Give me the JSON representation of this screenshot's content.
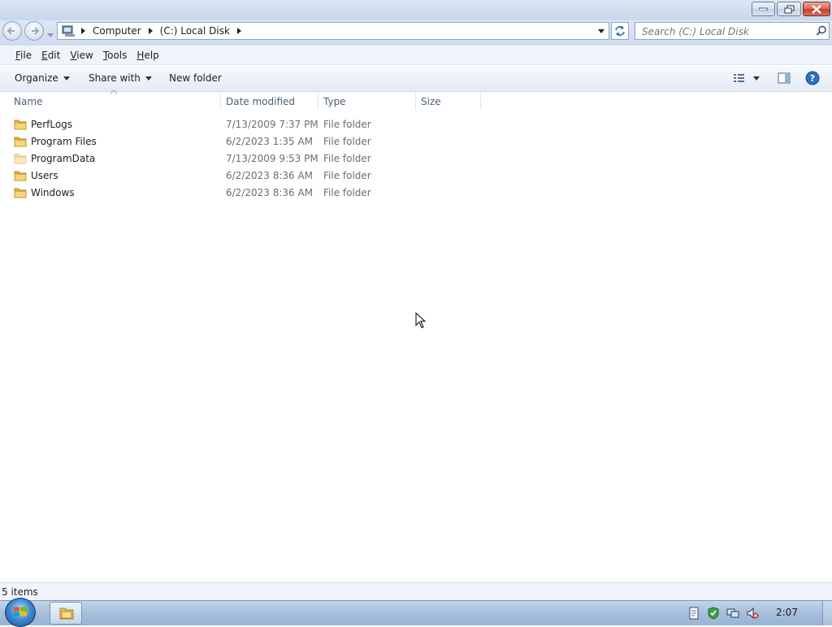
{
  "addressbar": {
    "breadcrumbs": [
      "Computer",
      "(C:) Local Disk"
    ],
    "search_placeholder": "Search (C:) Local Disk"
  },
  "menu": [
    {
      "label": "File",
      "key": "F",
      "rest": "ile"
    },
    {
      "label": "Edit",
      "key": "E",
      "rest": "dit"
    },
    {
      "label": "View",
      "key": "V",
      "rest": "iew"
    },
    {
      "label": "Tools",
      "key": "T",
      "rest": "ools"
    },
    {
      "label": "Help",
      "key": "H",
      "rest": "elp"
    }
  ],
  "commands": {
    "organize": "Organize",
    "share_with": "Share with",
    "new_folder": "New folder"
  },
  "columns": {
    "name": "Name",
    "date_modified": "Date modified",
    "type": "Type",
    "size": "Size"
  },
  "files": [
    {
      "name": "PerfLogs",
      "date": "7/13/2009 7:37 PM",
      "type": "File folder"
    },
    {
      "name": "Program Files",
      "date": "6/2/2023 1:35 AM",
      "type": "File folder"
    },
    {
      "name": "ProgramData",
      "date": "7/13/2009 9:53 PM",
      "type": "File folder"
    },
    {
      "name": "Users",
      "date": "6/2/2023 8:36 AM",
      "type": "File folder"
    },
    {
      "name": "Windows",
      "date": "6/2/2023 8:36 AM",
      "type": "File folder"
    }
  ],
  "status": {
    "items": "5 items"
  },
  "taskbar": {
    "clock": "2:07"
  }
}
